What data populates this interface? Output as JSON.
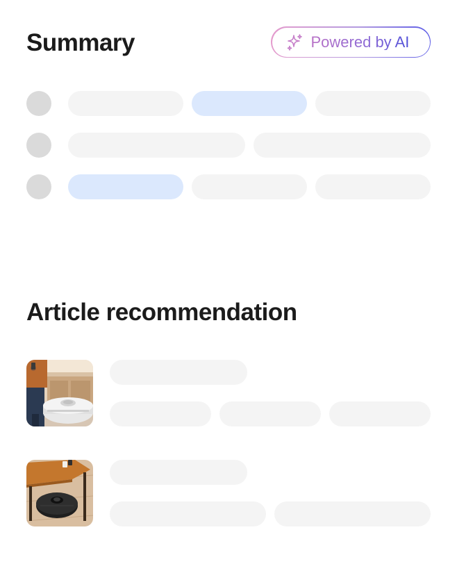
{
  "summary": {
    "title": "Summary",
    "badge": {
      "label": "Powered by AI",
      "icon": "sparkle-icon"
    }
  },
  "articles": {
    "title": "Article recommendation",
    "items": [
      {
        "thumbnail": "robot-vacuum-kitchen-photo"
      },
      {
        "thumbnail": "robot-vacuum-under-table-photo"
      }
    ]
  },
  "colors": {
    "skeleton": "#f4f4f4",
    "skeleton_highlight": "#dbe8fd",
    "avatar_placeholder": "#dadada",
    "badge_gradient_start": "#e59ccd",
    "badge_gradient_end": "#5b5be6"
  }
}
